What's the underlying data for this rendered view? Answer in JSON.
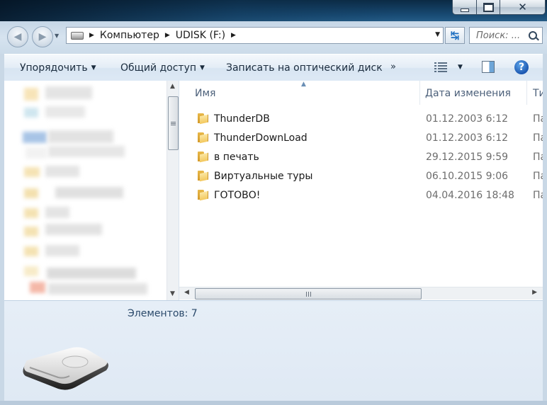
{
  "window": {
    "controls": {
      "minimize": "minimize-icon",
      "maximize": "maximize-icon",
      "close": "close-icon"
    }
  },
  "address_bar": {
    "crumbs": [
      "Компьютер",
      "UDISK (F:)"
    ],
    "search_placeholder": "Поиск: ..."
  },
  "toolbar": {
    "organize": "Упорядочить",
    "share": "Общий доступ",
    "burn": "Записать на оптический диск",
    "more": "»"
  },
  "columns": {
    "name": "Имя",
    "date": "Дата изменения",
    "type": "Ти"
  },
  "files": [
    {
      "name": "ThunderDB",
      "date": "01.12.2003 6:12",
      "type": "Па"
    },
    {
      "name": "ThunderDownLoad",
      "date": "01.12.2003 6:12",
      "type": "Па"
    },
    {
      "name": "в печать",
      "date": "29.12.2015 9:59",
      "type": "Па"
    },
    {
      "name": "Виртуальные туры",
      "date": "06.10.2015 9:06",
      "type": "Па"
    },
    {
      "name": "ГОТОВО!",
      "date": "04.04.2016 18:48",
      "type": "Па"
    }
  ],
  "details": {
    "count": "Элементов: 7"
  },
  "colors": {
    "accent": "#1f6fc1",
    "command_text": "#1b2c3e",
    "date_text": "#6d6d6d",
    "folder": "#f3c85e"
  }
}
